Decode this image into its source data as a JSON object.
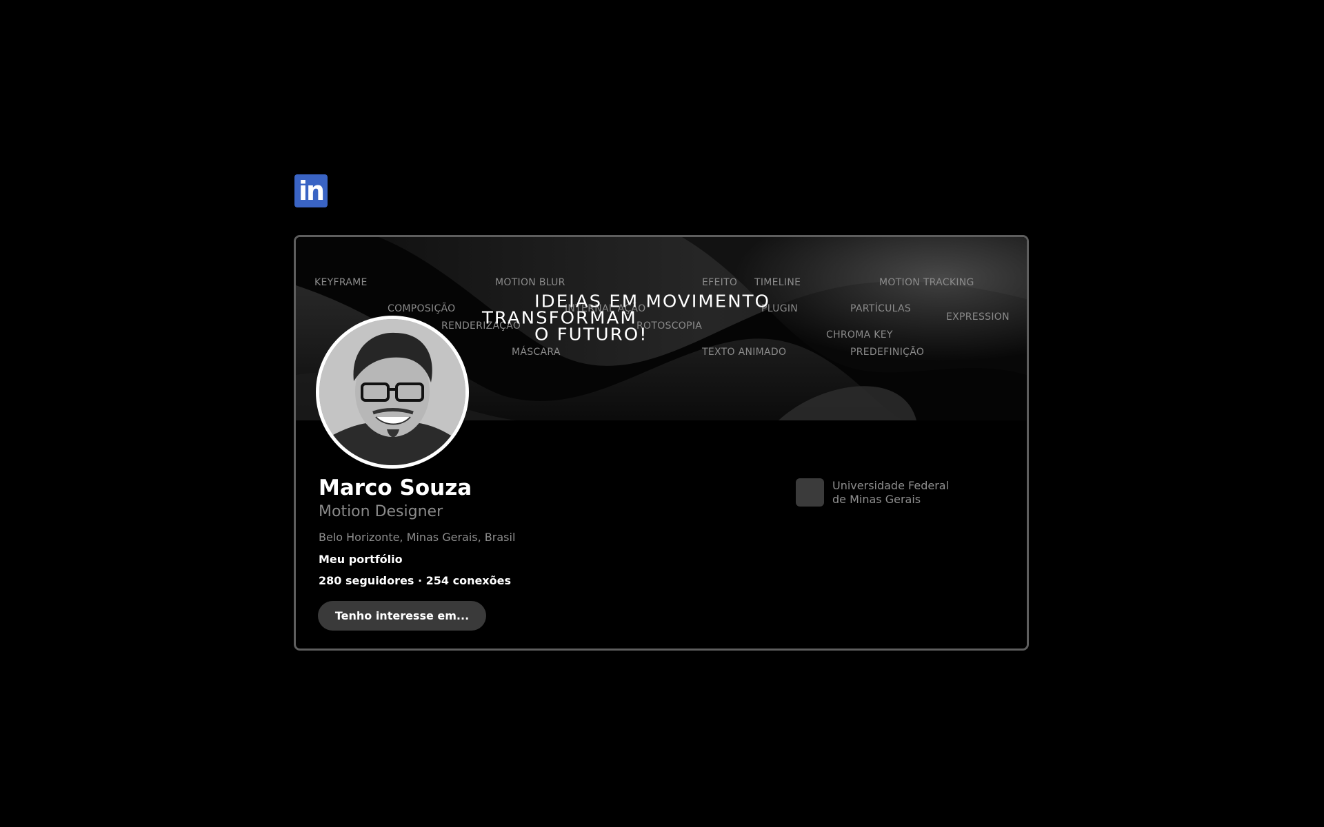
{
  "linkedin": {
    "logo_text": "in"
  },
  "banner": {
    "tags": [
      "KEYFRAME",
      "MOTION BLUR",
      "EFEITO",
      "TIMELINE",
      "MOTION TRACKING",
      "COMPOSIÇÃO",
      "INTERNAL AÇÃO",
      "PLUGIN",
      "PARTÍCULAS",
      "EXPRESSION",
      "RENDERIZAÇÃO",
      "ROTOSCOPIA",
      "CHROMA KEY",
      "MÁSCARA",
      "TEXTO ANIMADO",
      "PREDEFINIÇÃO"
    ],
    "headline": {
      "line1": "IDEIAS EM MOVIMENTO",
      "line2": "TRANSFORMAM",
      "line3": "O FUTURO!"
    }
  },
  "profile": {
    "name": "Marco Souza",
    "role": "Motion Designer",
    "location": "Belo Horizonte, Minas Gerais, Brasil",
    "portfolio_link": "Meu portfólio",
    "followers": "280 seguidores",
    "connections": "· 254 conexões",
    "interest_button": "Tenho interesse em..."
  },
  "education": {
    "name": "Universidade Federal\nde Minas Gerais"
  },
  "colors": {
    "linkedin_blue": "#3a64c4",
    "card_border": "#5e5e5e",
    "button_bg": "#3a3a3a"
  }
}
